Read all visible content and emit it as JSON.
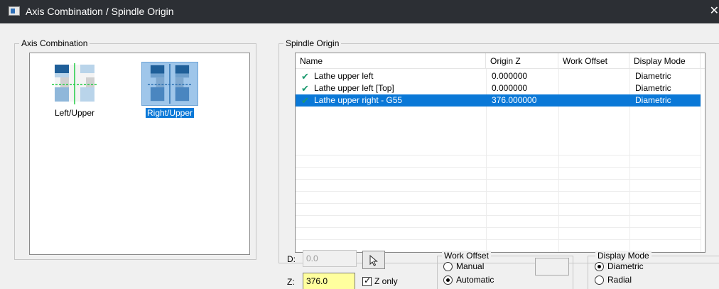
{
  "window": {
    "title": "Axis Combination / Spindle Origin",
    "close_glyph": "✕"
  },
  "axis_combination": {
    "label": "Axis Combination",
    "items": [
      {
        "label": "Left/Upper",
        "selected": false
      },
      {
        "label": "Right/Upper",
        "selected": true
      }
    ]
  },
  "spindle_origin": {
    "label": "Spindle Origin",
    "columns": [
      "Name",
      "Origin Z",
      "Work Offset",
      "Display Mode"
    ],
    "rows": [
      {
        "name": "Lathe upper left",
        "origin_z": "0.000000",
        "work_offset": "",
        "display_mode": "Diametric",
        "selected": false
      },
      {
        "name": "Lathe upper left [Top]",
        "origin_z": "0.000000",
        "work_offset": "",
        "display_mode": "Diametric",
        "selected": false
      },
      {
        "name": "Lathe upper right - G55",
        "origin_z": "376.000000",
        "work_offset": "",
        "display_mode": "Diametric",
        "selected": true
      }
    ]
  },
  "inputs": {
    "d_label": "D:",
    "d_value": "0.0",
    "z_label": "Z:",
    "z_value": "376.0",
    "z_only_label": "Z only",
    "z_only_checked": true
  },
  "work_offset": {
    "label": "Work Offset",
    "options": [
      "Manual",
      "Automatic"
    ],
    "selected": "Automatic"
  },
  "display_mode": {
    "label": "Display Mode",
    "options": [
      "Diametric",
      "Radial"
    ],
    "selected": "Diametric"
  },
  "colors": {
    "title_bar": "#2c2f34",
    "selection": "#0a78d7",
    "check_mark": "#1c9a6f",
    "z_input_bg": "#ffff9e"
  }
}
